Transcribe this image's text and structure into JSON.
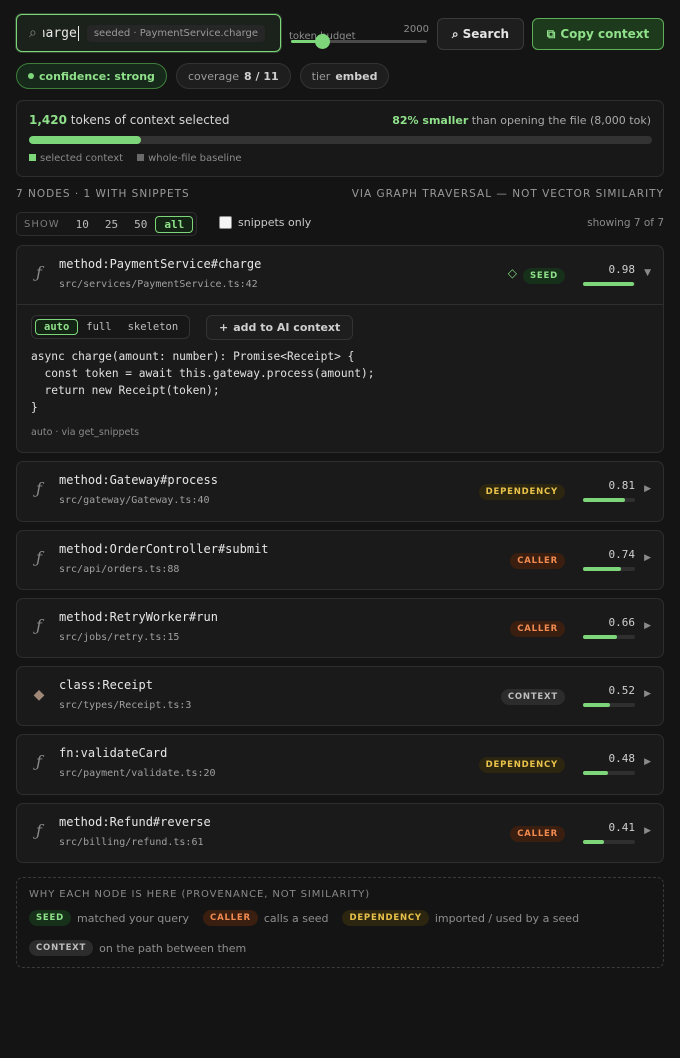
{
  "search": {
    "query": "charge",
    "seeded_chip": "seeded · PaymentService.charge",
    "budget_label": "token budget",
    "budget_value": "2000",
    "budget_fraction": 0.23,
    "search_label": "Search",
    "copy_label": "Copy context"
  },
  "chips": {
    "confidence": "confidence: strong",
    "coverage_label": "coverage",
    "coverage_value": "8 / 11",
    "tier_label": "tier",
    "tier_value": "embed"
  },
  "tokens": {
    "count": "1,420",
    "suffix": "tokens of context selected",
    "saving_pct": "82% smaller",
    "saving_rest": "than opening the file (8,000 tok)",
    "fraction": 0.18,
    "legend_selected": "selected context",
    "legend_baseline": "whole-file baseline",
    "color_selected": "#7ed67a",
    "color_baseline": "#6a6a6a"
  },
  "summary": {
    "left": "7 NODES · 1 WITH SNIPPETS",
    "right": "VIA GRAPH TRAVERSAL — NOT VECTOR SIMILARITY"
  },
  "show": {
    "label": "SHOW",
    "options": [
      "10",
      "25",
      "50",
      "all"
    ],
    "snippets_only": "snippets only",
    "showing": "showing 7 of 7"
  },
  "nodes": [
    {
      "name": "method:PaymentService#charge",
      "path": "src/services/PaymentService.ts:42",
      "badge": "SEED",
      "score": "0.98",
      "score_value": 0.98
    },
    {
      "name": "method:Gateway#process",
      "path": "src/gateway/Gateway.ts:40",
      "badge": "DEPENDENCY",
      "score": "0.81",
      "score_value": 0.81
    },
    {
      "name": "method:OrderController#submit",
      "path": "src/api/orders.ts:88",
      "badge": "CALLER",
      "score": "0.74",
      "score_value": 0.74
    },
    {
      "name": "method:RetryWorker#run",
      "path": "src/jobs/retry.ts:15",
      "badge": "CALLER",
      "score": "0.66",
      "score_value": 0.66
    },
    {
      "name": "class:Receipt",
      "path": "src/types/Receipt.ts:3",
      "badge": "CONTEXT",
      "score": "0.52",
      "score_value": 0.52
    },
    {
      "name": "fn:validateCard",
      "path": "src/payment/validate.ts:20",
      "badge": "DEPENDENCY",
      "score": "0.48",
      "score_value": 0.48
    },
    {
      "name": "method:Refund#reverse",
      "path": "src/billing/refund.ts:61",
      "badge": "CALLER",
      "score": "0.41",
      "score_value": 0.41
    }
  ],
  "snippet": {
    "modes": [
      "auto",
      "full",
      "skeleton"
    ],
    "add_label": "add to AI context",
    "code": "async charge(amount: number): Promise<Receipt> {\n  const token = await this.gateway.process(amount);\n  return new Receipt(token);\n}",
    "note": "auto · via get_snippets"
  },
  "provenance": {
    "title": "WHY EACH NODE IS HERE (PROVENANCE, NOT SIMILARITY)",
    "seed_badge": "SEED",
    "seed_text": "matched your query",
    "caller_badge": "CALLER",
    "caller_text": "calls a seed",
    "dependency_badge": "DEPENDENCY",
    "dependency_text": "imported / used by a seed",
    "context_badge": "CONTEXT",
    "context_text": "on the path between them"
  }
}
